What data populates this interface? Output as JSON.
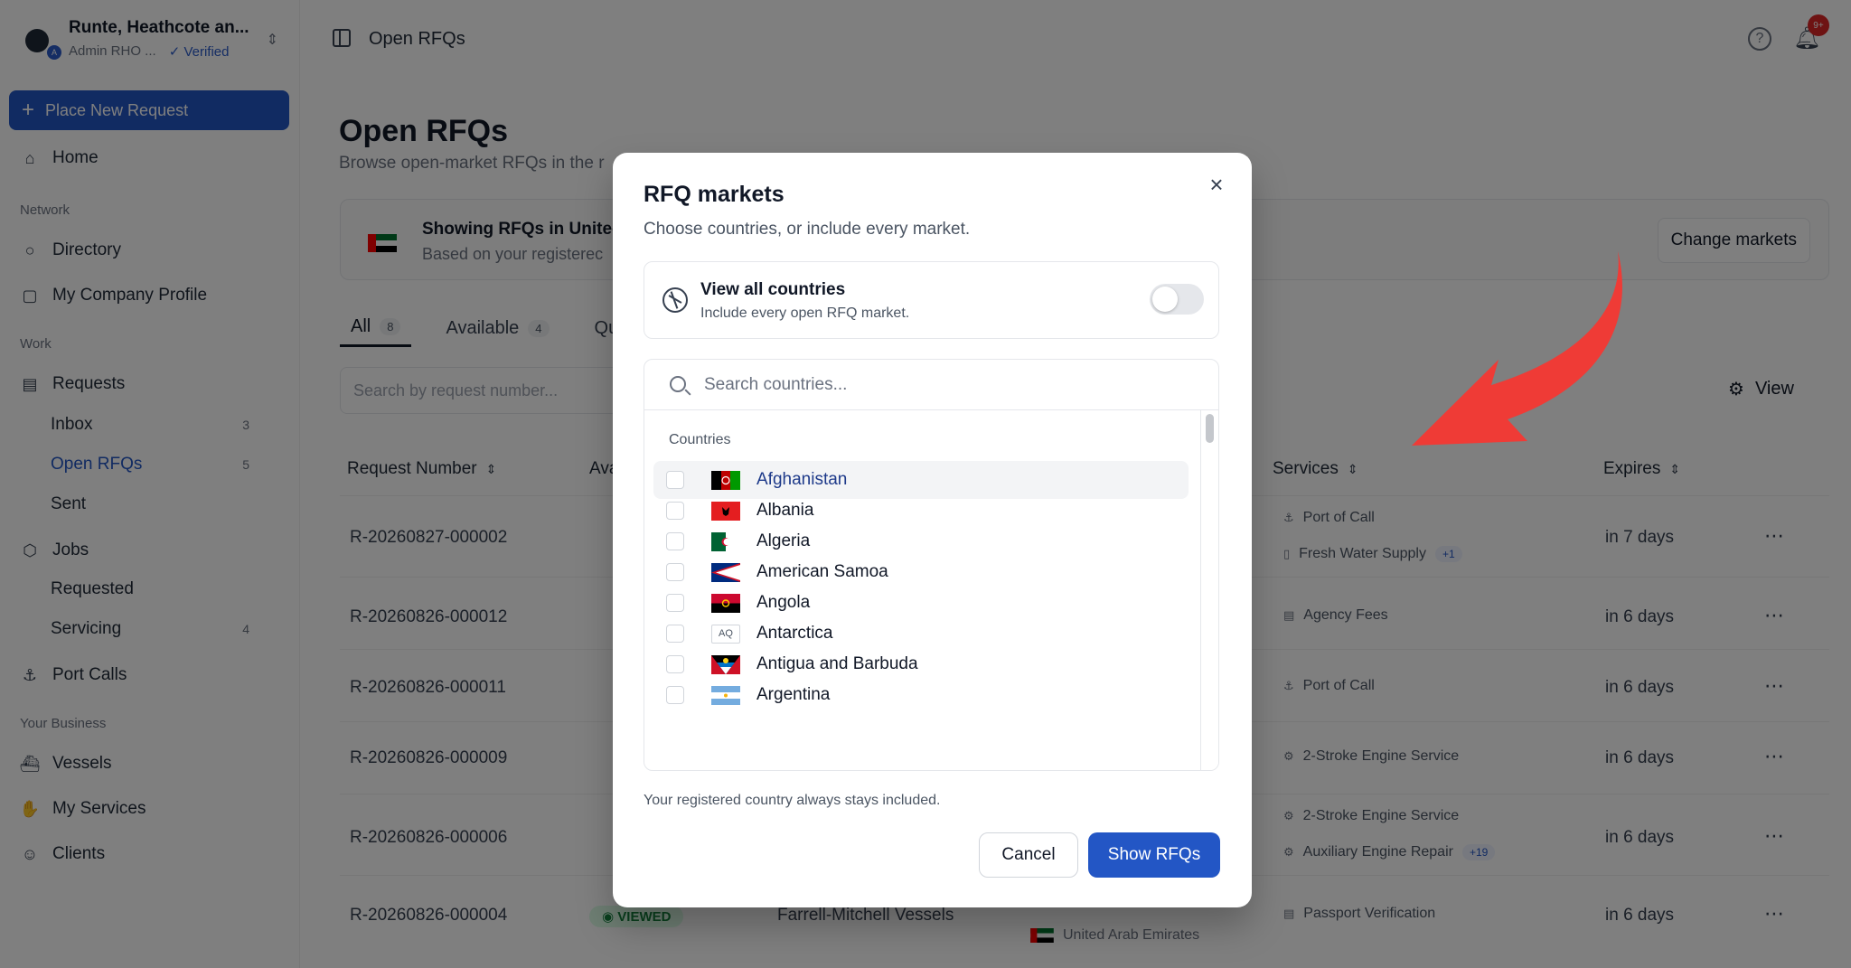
{
  "org": {
    "name": "Runte, Heathcote an...",
    "role": "Admin RHO ...",
    "verified": "Verified",
    "avatar_badge": "A"
  },
  "sidebar": {
    "primary_button": "Place New Request",
    "home": "Home",
    "section_network": "Network",
    "directory": "Directory",
    "company_profile": "My Company Profile",
    "section_work": "Work",
    "requests": "Requests",
    "inbox": "Inbox",
    "inbox_count": "3",
    "open_rfqs": "Open RFQs",
    "open_rfqs_count": "5",
    "sent": "Sent",
    "jobs": "Jobs",
    "requested": "Requested",
    "servicing": "Servicing",
    "servicing_count": "4",
    "port_calls": "Port Calls",
    "section_business": "Your Business",
    "vessels": "Vessels",
    "my_services": "My Services",
    "clients": "Clients"
  },
  "topbar": {
    "title": "Open RFQs",
    "help": "?",
    "notif_badge": "9+"
  },
  "page": {
    "title": "Open RFQs",
    "subtitle": "Browse open-market RFQs in the r",
    "market_title": "Showing RFQs in Unitec",
    "market_sub": "Based on your registerec",
    "change_markets": "Change markets",
    "tabs": [
      {
        "label": "All",
        "count": "8"
      },
      {
        "label": "Available",
        "count": "4"
      },
      {
        "label": "Qu",
        "count": ""
      }
    ],
    "search_placeholder": "Search by request number...",
    "view_label": "View",
    "columns": {
      "request_number": "Request Number",
      "availability": "Ava",
      "services": "Services",
      "expires": "Expires"
    },
    "rows": [
      {
        "req": "R-20260827-000002",
        "svc1": "Port of Call",
        "svc2": "Fresh Water Supply",
        "more": "+1",
        "exp": "in 7 days"
      },
      {
        "req": "R-20260826-000012",
        "svc1": "Agency Fees",
        "svc2": "",
        "more": "",
        "exp": "in 6 days"
      },
      {
        "req": "R-20260826-000011",
        "svc1": "Port of Call",
        "svc2": "",
        "more": "",
        "exp": "in 6 days"
      },
      {
        "req": "R-20260826-000009",
        "svc1": "2-Stroke Engine Service",
        "svc2": "",
        "more": "",
        "exp": "in 6 days"
      },
      {
        "req": "R-20260826-000006",
        "svc1": "2-Stroke Engine Service",
        "svc2": "Auxiliary Engine Repair",
        "more": "+19",
        "exp": "in 6 days"
      },
      {
        "req": "R-20260826-000004",
        "svc1": "Passport Verification",
        "svc2": "",
        "more": "",
        "exp": "in 6 days",
        "status": "VIEWED",
        "client": "Farrell-Mitchell Vessels",
        "country": "United Arab Emirates"
      }
    ]
  },
  "modal": {
    "title": "RFQ markets",
    "subtitle": "Choose countries, or include every market.",
    "view_all_title": "View all countries",
    "view_all_sub": "Include every open RFQ market.",
    "search_placeholder": "Search countries...",
    "list_label": "Countries",
    "countries": [
      "Afghanistan",
      "Albania",
      "Algeria",
      "American Samoa",
      "Angola",
      "Antarctica",
      "Antigua and Barbuda",
      "Argentina"
    ],
    "antarctica_code": "AQ",
    "note": "Your registered country always stays included.",
    "cancel": "Cancel",
    "show": "Show RFQs"
  },
  "colors": {
    "accent": "#2356c5",
    "arrow": "#ef3b36"
  }
}
